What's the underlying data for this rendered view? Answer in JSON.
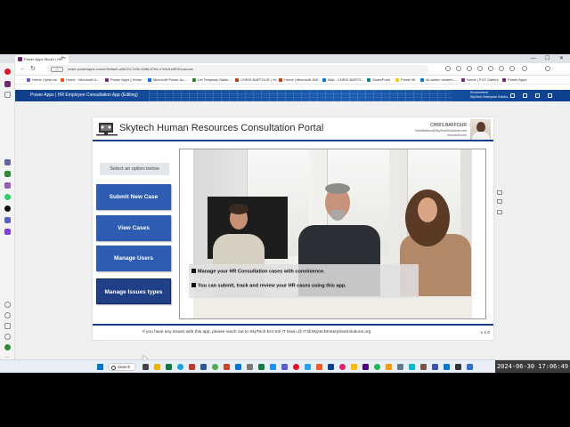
{
  "browser": {
    "tab_title": "Power Apps Studio | HR",
    "new_tab": "+",
    "url": "make.powerapps.com/e/Default-a3b224-7c5e-4568-87b9-c7e3d1e9f0f1/canvas",
    "lock_label": "ⓘ",
    "window_minimize": "—",
    "window_maximize": "☐",
    "window_close": "✕",
    "bookmarks": [
      "Home | lynd.ms",
      "Home - Microsoft A...",
      "Power Apps | Home",
      "Microsoft Power Au...",
      "Let Template Galler...",
      "CHRIS BAFFOUR | Yo...",
      "Home | Microsoft 365",
      "Mail - CHRIS BAFFO...",
      "SharePoint",
      "Power BI",
      "All admin centers -...",
      "Home | PCF Gallery",
      "Power Apps"
    ]
  },
  "powerapps": {
    "header_title": "Power Apps  |  HR Employee Consultation App (Editing)",
    "org_line1": "Environment",
    "org_line2": "SkyTech Enterprise Solutio..."
  },
  "app": {
    "title": "Skytech Human Resources Consultation Portal",
    "user_name": "CHRIS BAFFOUR",
    "user_email": "ChrisBaffour@SkyTechSolutions.com",
    "user_domain": "microsoft.com",
    "prompt": "Select an option below",
    "buttons": {
      "submit_new_case": "Submit New Case",
      "view_cases": "View Cases",
      "manage_users": "Manage Users",
      "manage_issues_types": "Manage Issues types"
    },
    "captions": {
      "line1": "Manage your HR Consultation cases with convinience.",
      "line2": "You can submit, track and review your HR cases using this app."
    },
    "footer": "If you have any issues with this app, please reach out to SkyTech Ent Sol IT team @ IT@SkytechEnterpriseSolutions.org",
    "version": "v 1.0"
  },
  "taskbar": {
    "search_label": "Search",
    "clock": "2024-06-30  17:06:49"
  },
  "colors": {
    "header_blue": "#0f3f8c",
    "button_blue": "#2d5cb1",
    "accent_line": "#1b3d8f"
  }
}
